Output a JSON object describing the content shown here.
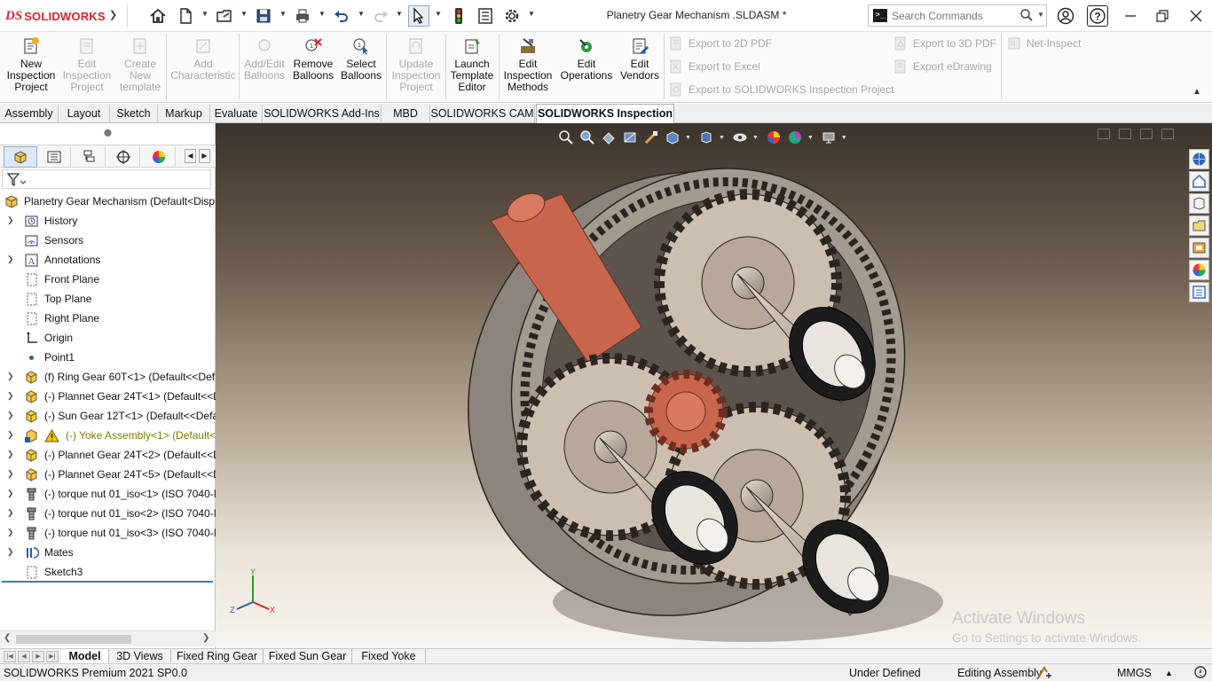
{
  "app": {
    "logo_mark": "DS",
    "logo_word": "SOLIDWORKS",
    "document_title": "Planetry Gear Mechanism .SLDASM *"
  },
  "quick_access": {
    "icons": [
      "home-icon",
      "new-document-icon",
      "open-folder-icon",
      "save-icon",
      "print-icon",
      "undo-icon",
      "redo-icon",
      "select-pointer-icon",
      "traffic-light-icon",
      "file-properties-icon",
      "options-gear-icon"
    ]
  },
  "search": {
    "placeholder": "Search Commands",
    "prefix_glyph": ">_"
  },
  "command_manager": {
    "buttons": [
      {
        "label": "New Inspection Project",
        "line1": "New",
        "line2": "Inspection",
        "line3": "Project",
        "enabled": true
      },
      {
        "label": "Edit Inspection Project",
        "line1": "Edit",
        "line2": "Inspection",
        "line3": "Project",
        "enabled": false
      },
      {
        "label": "Create New template",
        "line1": "Create",
        "line2": "New",
        "line3": "template",
        "enabled": false
      },
      {
        "label": "Add Characteristic",
        "line1": "Add",
        "line2": "Characteristic",
        "line3": "",
        "enabled": false
      },
      {
        "label": "Add/Edit Balloons",
        "line1": "Add/Edit",
        "line2": "Balloons",
        "line3": "",
        "enabled": false
      },
      {
        "label": "Remove Balloons",
        "line1": "Remove",
        "line2": "Balloons",
        "line3": "",
        "enabled": true
      },
      {
        "label": "Select Balloons",
        "line1": "Select",
        "line2": "Balloons",
        "line3": "",
        "enabled": true
      },
      {
        "label": "Update Inspection Project",
        "line1": "Update",
        "line2": "Inspection",
        "line3": "Project",
        "enabled": false
      },
      {
        "label": "Launch Template Editor",
        "line1": "Launch",
        "line2": "Template",
        "line3": "Editor",
        "enabled": true
      },
      {
        "label": "Edit Inspection Methods",
        "line1": "Edit",
        "line2": "Inspection",
        "line3": "Methods",
        "enabled": true
      },
      {
        "label": "Edit Operations",
        "line1": "Edit",
        "line2": "Operations",
        "line3": "",
        "enabled": true
      },
      {
        "label": "Edit Vendors",
        "line1": "Edit",
        "line2": "Vendors",
        "line3": "",
        "enabled": true
      }
    ],
    "exports": {
      "pdf2d": "Export to 2D PDF",
      "excel": "Export to Excel",
      "project": "Export to SOLIDWORKS Inspection Project",
      "pdf3d": "Export to 3D PDF",
      "edrawing": "Export eDrawing",
      "net_inspect": "Net-Inspect"
    }
  },
  "tabs": [
    "Assembly",
    "Layout",
    "Sketch",
    "Markup",
    "Evaluate",
    "SOLIDWORKS Add-Ins",
    "MBD",
    "SOLIDWORKS CAM",
    "SOLIDWORKS Inspection"
  ],
  "active_tab": "SOLIDWORKS Inspection",
  "feature_tree": {
    "root": "Planetry Gear Mechanism  (Default<Disp",
    "nodes": [
      {
        "label": "History",
        "icon": "history-folder-icon",
        "expandable": true
      },
      {
        "label": "Sensors",
        "icon": "sensors-icon",
        "expandable": false
      },
      {
        "label": "Annotations",
        "icon": "annotations-icon",
        "expandable": true
      },
      {
        "label": "Front Plane",
        "icon": "plane-icon",
        "expandable": false
      },
      {
        "label": "Top Plane",
        "icon": "plane-icon",
        "expandable": false
      },
      {
        "label": "Right Plane",
        "icon": "plane-icon",
        "expandable": false
      },
      {
        "label": "Origin",
        "icon": "origin-icon",
        "expandable": false
      },
      {
        "label": "Point1",
        "icon": "point-icon",
        "expandable": false
      },
      {
        "label": "(f) Ring Gear 60T<1> (Default<<Def",
        "icon": "part-icon",
        "expandable": true
      },
      {
        "label": "(-) Plannet Gear 24T<1> (Default<<D",
        "icon": "part-icon",
        "expandable": true
      },
      {
        "label": "(-) Sun Gear 12T<1> (Default<<Defa",
        "icon": "part-icon",
        "expandable": true
      },
      {
        "label": "(-) Yoke Assembly<1> (Default<",
        "icon": "subassembly-warning-icon",
        "expandable": true,
        "warning": true
      },
      {
        "label": "(-) Plannet Gear 24T<2> (Default<<D",
        "icon": "part-icon",
        "expandable": true
      },
      {
        "label": "(-) Plannet Gear 24T<5> (Default<<D",
        "icon": "part-icon",
        "expandable": true
      },
      {
        "label": "(-) torque nut 01_iso<1> (ISO 7040-M",
        "icon": "fastener-icon",
        "expandable": true
      },
      {
        "label": "(-) torque nut 01_iso<2> (ISO 7040-M",
        "icon": "fastener-icon",
        "expandable": true
      },
      {
        "label": "(-) torque nut 01_iso<3> (ISO 7040-M",
        "icon": "fastener-icon",
        "expandable": true
      },
      {
        "label": "Mates",
        "icon": "mates-icon",
        "expandable": true
      },
      {
        "label": "Sketch3",
        "icon": "sketch-icon",
        "expandable": false
      }
    ]
  },
  "viewport": {
    "triad": {
      "x": "X",
      "y": "Y",
      "z": "Z"
    },
    "watermark_line1": "Activate Windows",
    "watermark_line2": "Go to Settings to activate Windows."
  },
  "bottom_tabs": [
    "Model",
    "3D Views",
    "Fixed Ring Gear",
    "Fixed Sun Gear",
    "Fixed Yoke"
  ],
  "active_bottom_tab": "Model",
  "status": {
    "product": "SOLIDWORKS Premium 2021 SP0.0",
    "definition": "Under Defined",
    "mode": "Editing Assembly",
    "units": "MMGS"
  },
  "colors": {
    "brand_red": "#d8262c",
    "selection_blue": "#2c7fd0",
    "sun_gear": "#c8664d",
    "gear_metal": "#cdbfb0",
    "bearing_black": "#1c1c1c"
  }
}
